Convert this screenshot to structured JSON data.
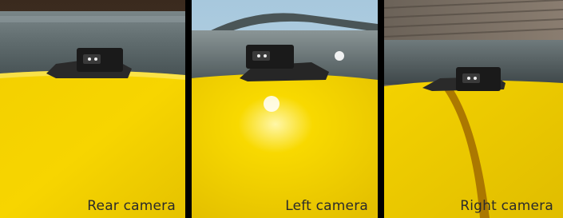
{
  "panels": [
    {
      "caption": "Rear camera"
    },
    {
      "caption": "Left camera"
    },
    {
      "caption": "Right camera"
    }
  ],
  "colors": {
    "body_yellow": "#f7d400",
    "pipe_gray": "#5e6b6e",
    "camera_black": "#1a1a1a",
    "divider": "#000000"
  }
}
